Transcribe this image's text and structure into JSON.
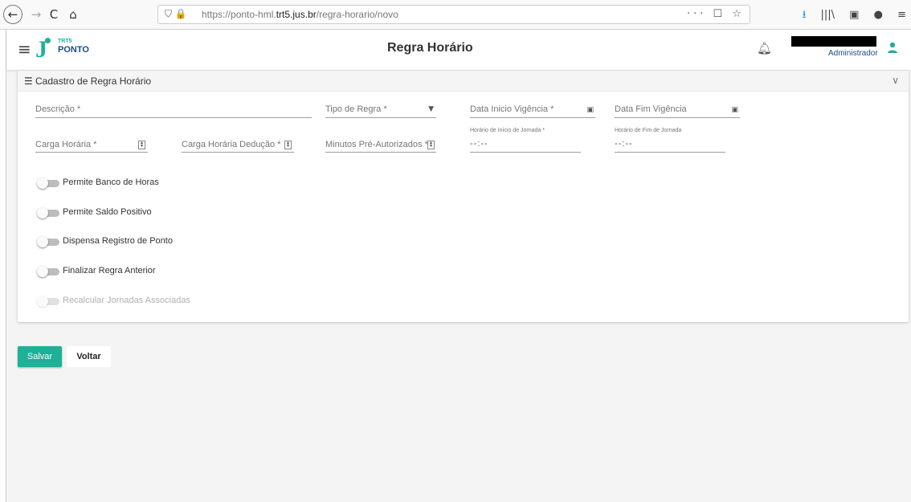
{
  "browser": {
    "back_icon": "←",
    "forward_icon": "→",
    "reload_icon": "C",
    "home_icon": "⌂",
    "url_prefix": "https://ponto-hml.",
    "url_domain": "trt5.jus.br",
    "url_path": "/regra-horario/novo",
    "page_actions": "··· ☐ ☆",
    "tools": [
      "⭳",
      "|||\\",
      "▣",
      "●",
      "≡"
    ]
  },
  "header": {
    "logo_small": "TRT5",
    "logo_name": "PONTO",
    "title": "Regra Horário",
    "user_role": "Administrador",
    "brand_color": "#1db198"
  },
  "card": {
    "title": "Cadastro de Regra Horário"
  },
  "form": {
    "descricao_label": "Descrição *",
    "tipo_regra_label": "Tipo de Regra *",
    "data_inicio_label": "Data Inicio Vigência *",
    "data_fim_label": "Data Fim Vigência",
    "carga_horaria_label": "Carga Horária *",
    "carga_deducao_label": "Carga Horária Dedução *",
    "minutos_label": "Minutos Pré-Autorizados *",
    "inicio_jornada_label": "Horário de Início de Jornada *",
    "inicio_jornada_value": "--:--",
    "fim_jornada_label": "Horário de Fim de Jornada",
    "fim_jornada_value": "--:--"
  },
  "toggles": [
    {
      "label": "Permite Banco de Horas",
      "enabled": true
    },
    {
      "label": "Permite Saldo Positivo",
      "enabled": true
    },
    {
      "label": "Dispensa Registro de Ponto",
      "enabled": true
    },
    {
      "label": "Finalizar Regra Anterior",
      "enabled": true
    },
    {
      "label": "Recalcular Jornadas Associadas",
      "enabled": false
    }
  ],
  "actions": {
    "save_label": "Salvar",
    "back_label": "Voltar"
  }
}
